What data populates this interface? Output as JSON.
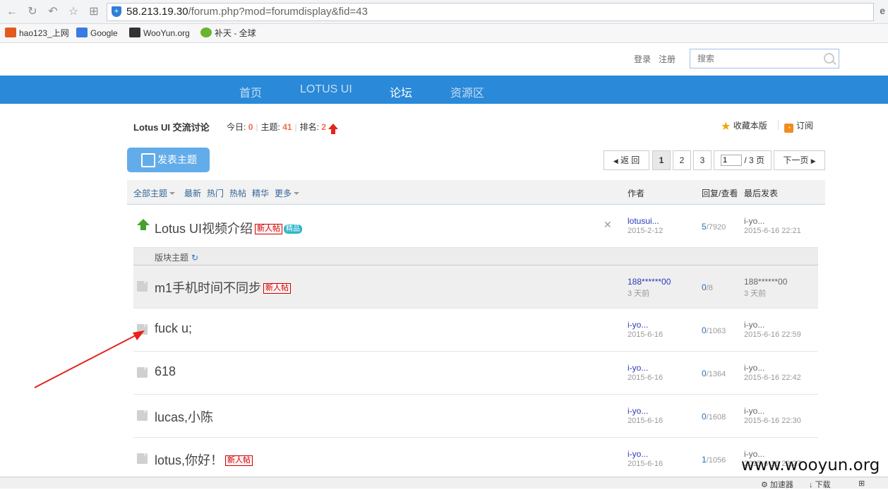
{
  "browser": {
    "url_host": "58.213.19.30",
    "url_path": "/forum.php?mod=forumdisplay&fid=43",
    "bookmarks": [
      {
        "label": "hao123_上网",
        "icon": "hao123-icon",
        "color": "#e35a1e"
      },
      {
        "label": "Google",
        "icon": "google-icon",
        "color": "#3a7be0"
      },
      {
        "label": "WooYun.org",
        "icon": "wooyun-icon",
        "color": "#333333"
      },
      {
        "label": "补天 - 全球",
        "icon": "butian-icon",
        "color": "#6ab42e"
      }
    ]
  },
  "header": {
    "login": "登录",
    "register": "注册",
    "search_placeholder": "搜索"
  },
  "nav": {
    "items": [
      {
        "label": "首页",
        "active": false
      },
      {
        "label": "LOTUS UI",
        "active": false
      },
      {
        "label": "论坛",
        "active": true
      },
      {
        "label": "资源区",
        "active": false
      }
    ],
    "color": "#2a89d8"
  },
  "forum": {
    "title": "Lotus UI 交流讨论",
    "today_label": "今日:",
    "today": "0",
    "topics_label": "主题:",
    "topics": "41",
    "rank_label": "排名:",
    "rank": "2",
    "favorite": "收藏本版",
    "subscribe": "订阅"
  },
  "toolbar": {
    "post_label": "发表主题",
    "back_label": "返 回",
    "pages": [
      "1",
      "2",
      "3"
    ],
    "current_page": "1",
    "page_input": "1",
    "page_total": "/ 3 页",
    "next_label": "下一页"
  },
  "list_header": {
    "tabs": [
      "全部主题",
      "最新",
      "热门",
      "热帖",
      "精华",
      "更多"
    ],
    "author": "作者",
    "replies": "回复/查看",
    "last_post": "最后发表"
  },
  "sticky": {
    "title": "Lotus UI视频介绍",
    "badge_new": "新人帖",
    "badge_jing": "精品",
    "author": "lotusui...",
    "date": "2015-2-12",
    "replies": "5",
    "views": "/7920",
    "last_author": "i-yo...",
    "last_date": "2015-6-16 22:21"
  },
  "section_label": "版块主题",
  "threads": [
    {
      "title": "m1手机时间不同步",
      "badge": "新人帖",
      "author": "188******00",
      "date": "3 天前",
      "replies": "0",
      "views": "/8",
      "last_author": "188******00",
      "last_date": "3 天前"
    },
    {
      "title": "fuck u;",
      "badge": "",
      "author": "i-yo...",
      "date": "2015-6-16",
      "replies": "0",
      "views": "/1063",
      "last_author": "i-yo...",
      "last_date": "2015-6-16 22:59"
    },
    {
      "title": "618",
      "badge": "",
      "author": "i-yo...",
      "date": "2015-6-16",
      "replies": "0",
      "views": "/1364",
      "last_author": "i-yo...",
      "last_date": "2015-6-16 22:42"
    },
    {
      "title": "lucas,小陈",
      "badge": "",
      "author": "i-yo...",
      "date": "2015-6-16",
      "replies": "0",
      "views": "/1608",
      "last_author": "i-yo...",
      "last_date": "2015-6-16 22:30"
    },
    {
      "title": "lotus,你好！",
      "badge": "新人帖",
      "author": "i-yo...",
      "date": "2015-6-16",
      "replies": "1",
      "views": "/1056",
      "last_author": "i-yo...",
      "last_date": "2015-6-16 22:27"
    }
  ],
  "watermark": "www.wooyun.org",
  "statusbar": {
    "accelerator": "加速器",
    "download": "下载"
  },
  "annotation_color": "#e8201b"
}
